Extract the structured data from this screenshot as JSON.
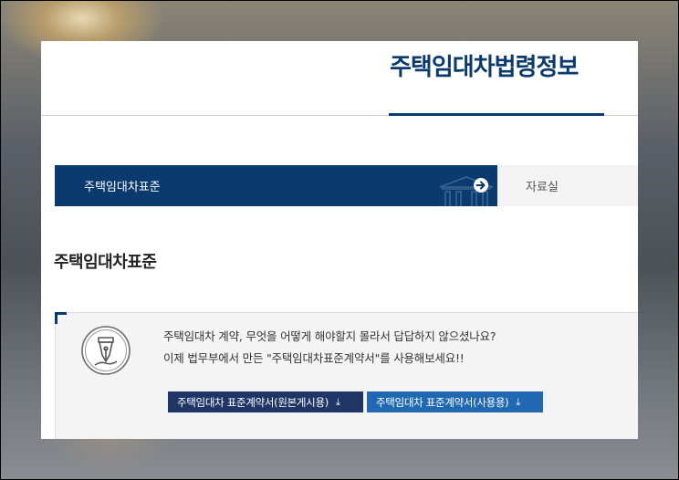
{
  "header": {
    "site_title": "주택임대차법령정보"
  },
  "tabs": [
    {
      "label": "주택임대차표준",
      "active": true
    },
    {
      "label": "자료실",
      "active": false
    }
  ],
  "section": {
    "title": "주택임대차표준"
  },
  "info": {
    "line1": "주택임대차 계약, 무엇을 어떻게 해야할지 몰라서 답답하지 않으셨나요?",
    "line2": "이제 법무부에서 만든 \"주택임대차표준계약서\"를 사용해보세요!!",
    "icon": "fountain-pen-icon"
  },
  "buttons": {
    "original_label": "주택임대차 표준계약서(원본게시용)",
    "use_label": "주택임대차 표준계약서(사용용)",
    "download_glyph": "⤓"
  },
  "colors": {
    "brand_navy": "#0b3a6e",
    "button_dark": "#1f3566",
    "button_blue": "#2069b2",
    "tab_inactive_bg": "#f3f3f3"
  }
}
